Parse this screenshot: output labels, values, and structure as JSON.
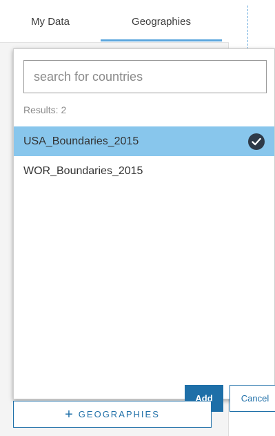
{
  "tabs": [
    {
      "label": "My Data"
    },
    {
      "label": "Geographies",
      "active": true
    }
  ],
  "search": {
    "placeholder": "search for countries",
    "value": ""
  },
  "results": {
    "label": "Results: 2",
    "items": [
      {
        "label": "USA_Boundaries_2015",
        "selected": true
      },
      {
        "label": "WOR_Boundaries_2015",
        "selected": false
      }
    ]
  },
  "buttons": {
    "add": "Add",
    "cancel": "Cancel"
  },
  "add_geographies": {
    "icon": "plus-icon",
    "label": "GEOGRAPHIES"
  },
  "colors": {
    "accent": "#1e6fa8",
    "tab_underline": "#5aa6dd",
    "selected_row": "#88c6ec",
    "check_badge": "#2e3a48"
  }
}
